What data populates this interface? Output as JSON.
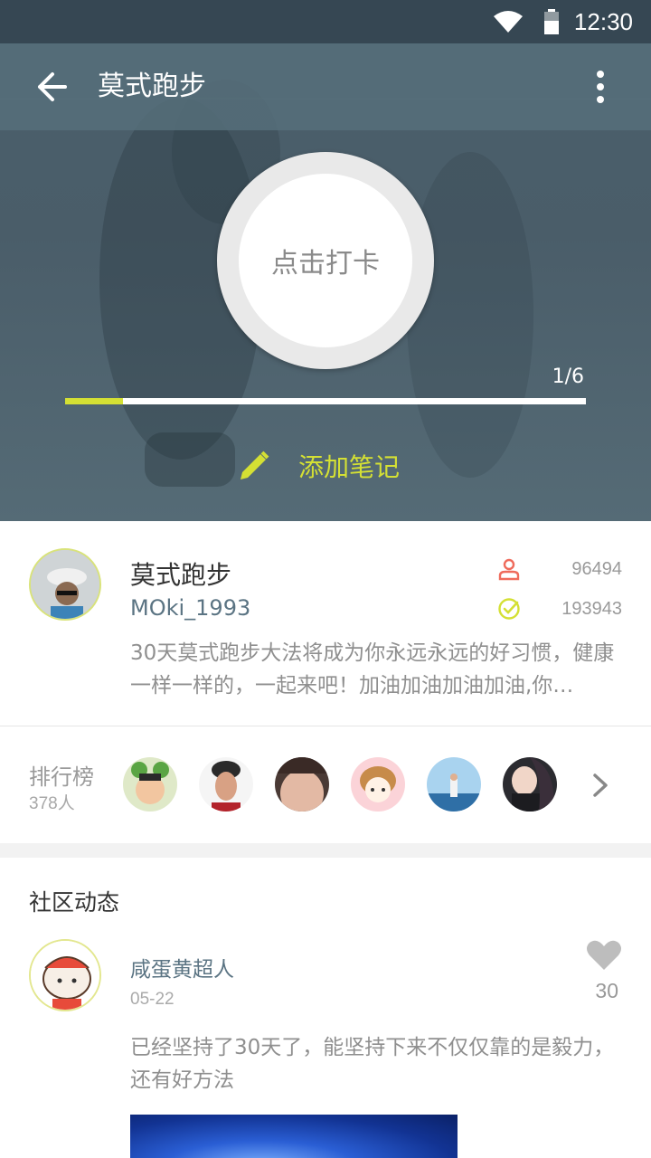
{
  "status_bar": {
    "time": "12:30"
  },
  "app_bar": {
    "title": "莫式跑步"
  },
  "hero": {
    "checkin_label": "点击打卡",
    "progress_text": "1/6",
    "progress_fraction": 0.1111,
    "add_note_label": "添加笔记",
    "accent_color": "#d4e034"
  },
  "info": {
    "title": "莫式跑步",
    "username": "MOki_1993",
    "members_count": "96494",
    "checkins_count": "193943",
    "description": "30天莫式跑步大法将成为你永远永远的好习惯，健康一样一样的，一起来吧！加油加油加油加油,你…"
  },
  "ranking": {
    "label": "排行榜",
    "count": "378人"
  },
  "community": {
    "title": "社区动态",
    "post": {
      "author": "咸蛋黄超人",
      "date": "05-22",
      "likes": "30",
      "text": "已经坚持了30天了，能坚持下来不仅仅靠的是毅力，还有好方法"
    }
  }
}
